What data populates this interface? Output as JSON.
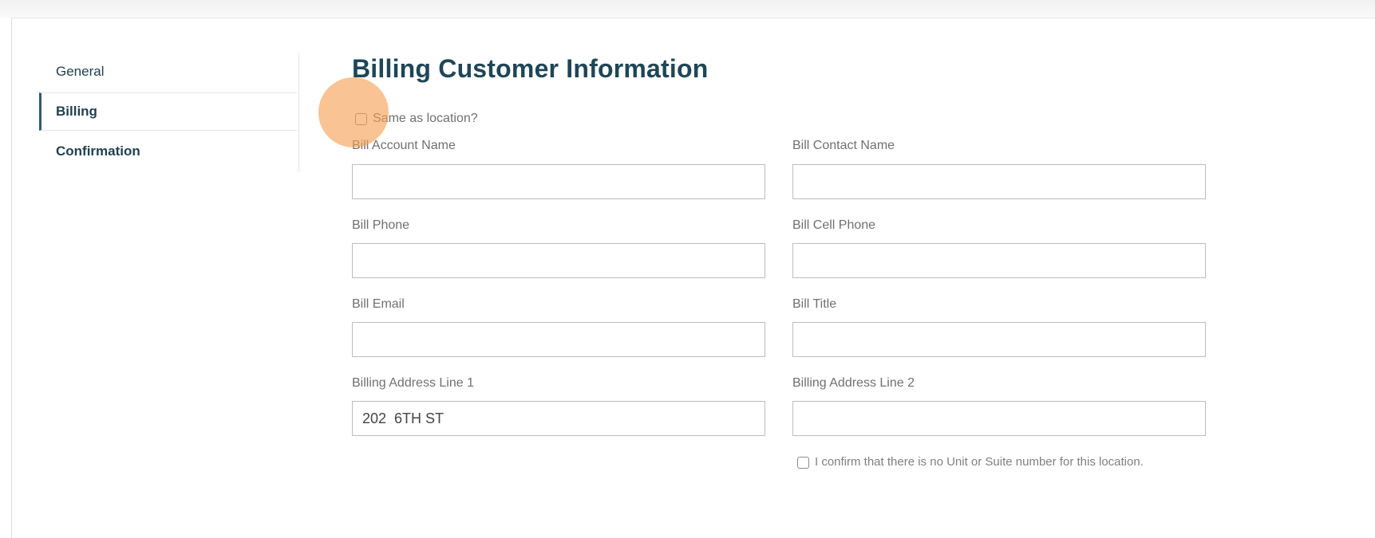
{
  "sidebar": {
    "items": [
      {
        "label": "General"
      },
      {
        "label": "Billing"
      },
      {
        "label": "Confirmation"
      }
    ]
  },
  "main": {
    "title": "Billing Customer Information",
    "same_as_location_label": "Same as location?",
    "fields": {
      "bill_account_name": {
        "label": "Bill Account Name",
        "value": ""
      },
      "bill_contact_name": {
        "label": "Bill Contact Name",
        "value": ""
      },
      "bill_phone": {
        "label": "Bill Phone",
        "value": ""
      },
      "bill_cell_phone": {
        "label": "Bill Cell Phone",
        "value": ""
      },
      "bill_email": {
        "label": "Bill Email",
        "value": ""
      },
      "bill_title": {
        "label": "Bill Title",
        "value": ""
      },
      "billing_address_line_1": {
        "label": "Billing Address Line 1",
        "value": "202  6TH ST"
      },
      "billing_address_line_2": {
        "label": "Billing Address Line 2",
        "value": ""
      }
    },
    "confirm_no_unit_label": "I confirm that there is no Unit or Suite number for this location."
  },
  "colors": {
    "heading": "#1e4656",
    "sidebar_text": "#1f3f4f",
    "active_indicator": "#2f5b73",
    "click_highlight": "#f59e50"
  }
}
